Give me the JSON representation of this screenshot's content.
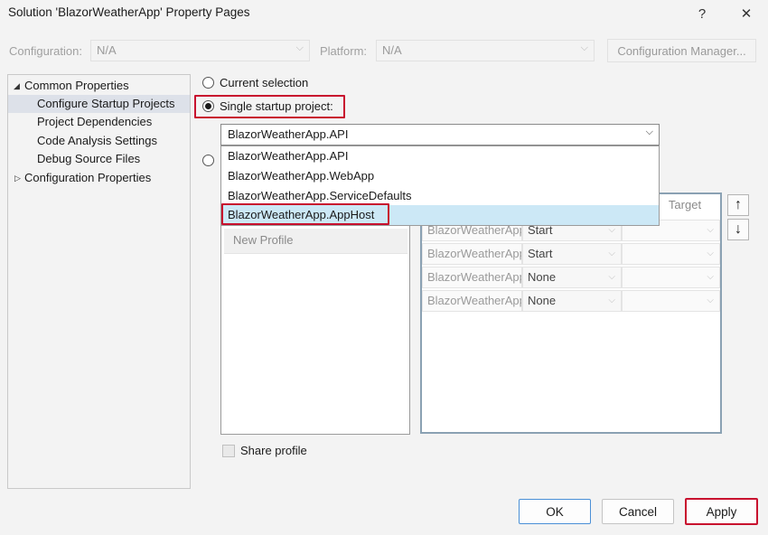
{
  "window": {
    "title": "Solution 'BlazorWeatherApp' Property Pages",
    "help_glyph": "?",
    "close_glyph": "✕"
  },
  "config_bar": {
    "configuration_label": "Configuration:",
    "configuration_value": "N/A",
    "platform_label": "Platform:",
    "platform_value": "N/A",
    "config_manager_label": "Configuration Manager..."
  },
  "tree": {
    "items": [
      {
        "label": "Common Properties",
        "expanded": true
      },
      {
        "label": "Configure Startup Projects",
        "selected": true
      },
      {
        "label": "Project Dependencies"
      },
      {
        "label": "Code Analysis Settings"
      },
      {
        "label": "Debug Source Files"
      },
      {
        "label": "Configuration Properties",
        "expanded": false
      }
    ]
  },
  "startup": {
    "current_selection_label": "Current selection",
    "single_startup_label": "Single startup project:",
    "selected_project": "BlazorWeatherApp.API",
    "options": [
      "BlazorWeatherApp.API",
      "BlazorWeatherApp.WebApp",
      "BlazorWeatherApp.ServiceDefaults",
      "BlazorWeatherApp.AppHost"
    ],
    "highlighted_option": "BlazorWeatherApp.AppHost"
  },
  "profiles": {
    "new_profile_label": "New Profile",
    "target_header": "Target",
    "rows": [
      {
        "project": "BlazorWeatherApp",
        "action": "Start"
      },
      {
        "project": "BlazorWeatherApp",
        "action": "Start"
      },
      {
        "project": "BlazorWeatherApp",
        "action": "None"
      },
      {
        "project": "BlazorWeatherApp",
        "action": "None"
      }
    ],
    "move_up_glyph": "↑",
    "move_down_glyph": "↓",
    "share_profile_label": "Share profile"
  },
  "footer": {
    "ok_label": "OK",
    "cancel_label": "Cancel",
    "apply_label": "Apply"
  },
  "colors": {
    "highlight_box": "#c8102e",
    "selection_highlight": "#cce8f6",
    "tree_selection": "#dde1e9"
  }
}
